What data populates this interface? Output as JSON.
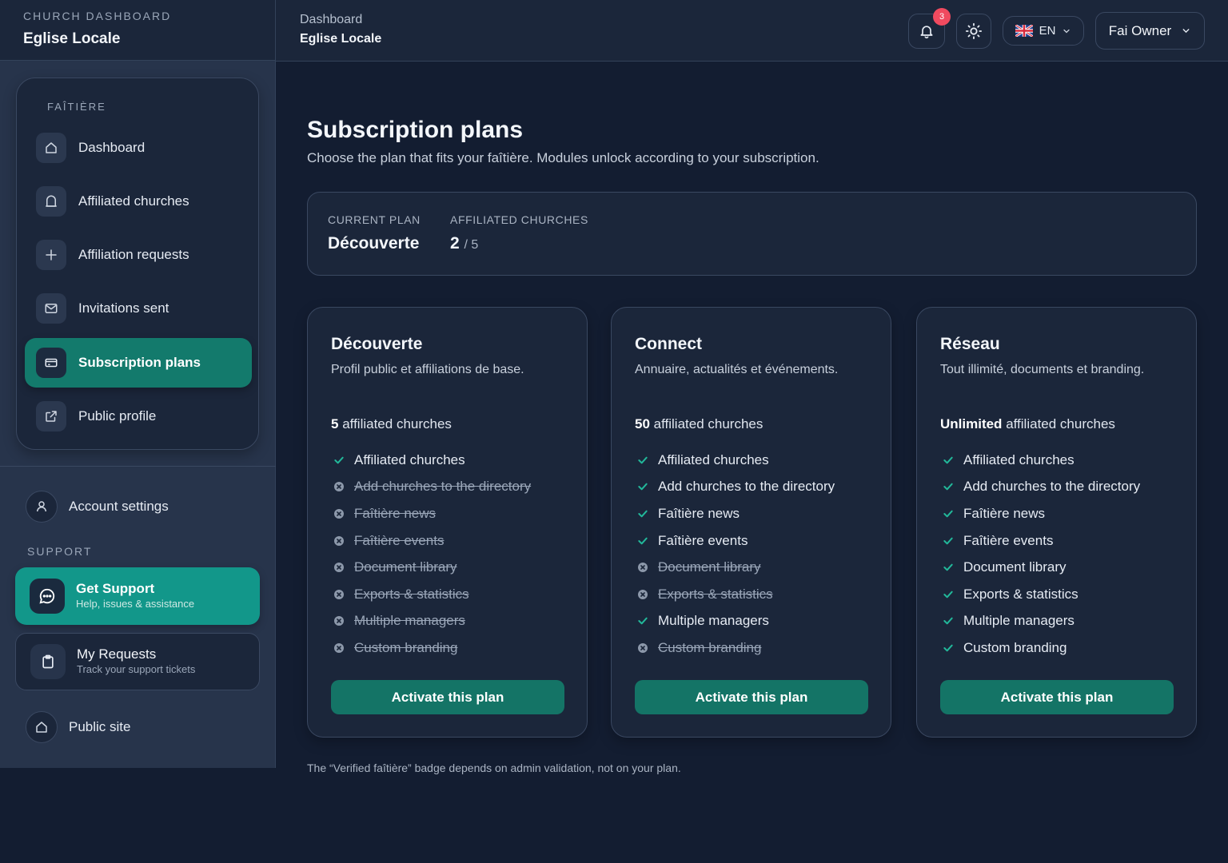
{
  "sidebar": {
    "eyebrow": "CHURCH DASHBOARD",
    "org_name": "Eglise Locale",
    "section_label": "FAÎTIÈRE",
    "nav": [
      {
        "label": "Dashboard",
        "icon": "home-icon"
      },
      {
        "label": "Affiliated churches",
        "icon": "church-icon"
      },
      {
        "label": "Affiliation requests",
        "icon": "plus-icon"
      },
      {
        "label": "Invitations sent",
        "icon": "mail-icon"
      },
      {
        "label": "Subscription plans",
        "icon": "credit-card-icon",
        "active": true
      },
      {
        "label": "Public profile",
        "icon": "external-link-icon"
      }
    ],
    "account_settings": "Account settings",
    "support_label": "SUPPORT",
    "get_support": {
      "title": "Get Support",
      "subtitle": "Help, issues & assistance"
    },
    "my_requests": {
      "title": "My Requests",
      "subtitle": "Track your support tickets"
    },
    "public_site": "Public site"
  },
  "topbar": {
    "breadcrumb_parent": "Dashboard",
    "breadcrumb_current": "Eglise Locale",
    "notification_count": "3",
    "language": "EN",
    "user_name": "Fai Owner"
  },
  "main": {
    "title": "Subscription plans",
    "subtitle": "Choose the plan that fits your faîtière. Modules unlock according to your subscription.",
    "current": {
      "plan_label": "CURRENT PLAN",
      "plan_value": "Découverte",
      "churches_label": "AFFILIATED CHURCHES",
      "churches_used": "2",
      "churches_total": "/ 5"
    },
    "plans": [
      {
        "name": "Découverte",
        "description": "Profil public et affiliations de base.",
        "limit_value": "5",
        "limit_suffix": "affiliated churches",
        "features": [
          {
            "label": "Affiliated churches",
            "included": true
          },
          {
            "label": "Add churches to the directory",
            "included": false
          },
          {
            "label": "Faîtière news",
            "included": false
          },
          {
            "label": "Faîtière events",
            "included": false
          },
          {
            "label": "Document library",
            "included": false
          },
          {
            "label": "Exports & statistics",
            "included": false
          },
          {
            "label": "Multiple managers",
            "included": false
          },
          {
            "label": "Custom branding",
            "included": false
          }
        ],
        "button": "Activate this plan"
      },
      {
        "name": "Connect",
        "description": "Annuaire, actualités et événements.",
        "limit_value": "50",
        "limit_suffix": "affiliated churches",
        "features": [
          {
            "label": "Affiliated churches",
            "included": true
          },
          {
            "label": "Add churches to the directory",
            "included": true
          },
          {
            "label": "Faîtière news",
            "included": true
          },
          {
            "label": "Faîtière events",
            "included": true
          },
          {
            "label": "Document library",
            "included": false
          },
          {
            "label": "Exports & statistics",
            "included": false
          },
          {
            "label": "Multiple managers",
            "included": true
          },
          {
            "label": "Custom branding",
            "included": false
          }
        ],
        "button": "Activate this plan"
      },
      {
        "name": "Réseau",
        "description": "Tout illimité, documents et branding.",
        "limit_value": "Unlimited",
        "limit_suffix": "affiliated churches",
        "features": [
          {
            "label": "Affiliated churches",
            "included": true
          },
          {
            "label": "Add churches to the directory",
            "included": true
          },
          {
            "label": "Faîtière news",
            "included": true
          },
          {
            "label": "Faîtière events",
            "included": true
          },
          {
            "label": "Document library",
            "included": true
          },
          {
            "label": "Exports & statistics",
            "included": true
          },
          {
            "label": "Multiple managers",
            "included": true
          },
          {
            "label": "Custom branding",
            "included": true
          }
        ],
        "button": "Activate this plan"
      }
    ],
    "footnote": "The “Verified faîtière” badge depends on admin validation, not on your plan."
  },
  "colors": {
    "accent": "#137a6c",
    "check": "#22b89a",
    "badge": "#f04a5f",
    "background": "#131d31"
  }
}
